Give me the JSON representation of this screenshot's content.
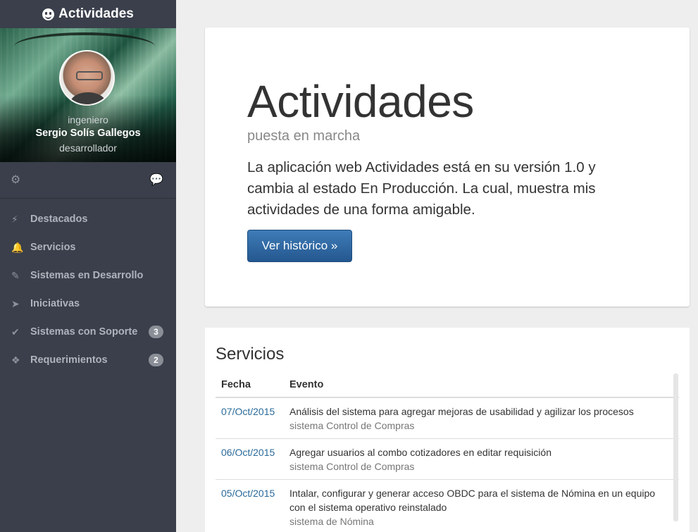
{
  "app": {
    "brand": "Actividades",
    "brand_icon": "smiley-icon"
  },
  "profile": {
    "title": "ingeniero",
    "name": "Sergio Solís Gallegos",
    "role": "desarrollador"
  },
  "tools": {
    "settings_icon": "gear-icon",
    "chat_icon": "comment-icon"
  },
  "menu": {
    "items": [
      {
        "label": "Destacados",
        "icon": "bolt-icon",
        "glyph": "⚡",
        "badge": ""
      },
      {
        "label": "Servicios",
        "icon": "bell-icon",
        "glyph": "🔔",
        "badge": ""
      },
      {
        "label": "Sistemas en Desarrollo",
        "icon": "pencil-icon",
        "glyph": "✎",
        "badge": ""
      },
      {
        "label": "Iniciativas",
        "icon": "send-icon",
        "glyph": "➤",
        "badge": ""
      },
      {
        "label": "Sistemas con Soporte",
        "icon": "check-icon",
        "glyph": "✔",
        "badge": "3"
      },
      {
        "label": "Requerimientos",
        "icon": "gift-icon",
        "glyph": "❖",
        "badge": "2"
      }
    ]
  },
  "jumbotron": {
    "title": "Actividades",
    "subtitle": "puesta en marcha",
    "lead": "La aplicación web Actividades está en su versión 1.0 y cambia al estado En Producción. La cual, muestra mis actividades de una forma amigable.",
    "button": "Ver histórico »"
  },
  "services": {
    "heading": "Servicios",
    "columns": [
      "Fecha",
      "Evento"
    ],
    "rows": [
      {
        "date": "07/Oct/2015",
        "event": "Análisis del sistema para agregar mejoras de usabilidad y agilizar los procesos",
        "system": "sistema Control de Compras"
      },
      {
        "date": "06/Oct/2015",
        "event": "Agregar usuarios al combo cotizadores en editar requisición",
        "system": "sistema Control de Compras"
      },
      {
        "date": "05/Oct/2015",
        "event": "Intalar, configurar y generar acceso OBDC para el sistema de Nómina en un equipo con el sistema operativo reinstalado",
        "system": "sistema de Nómina"
      }
    ]
  },
  "colors": {
    "sidebar": "#3a3f4b",
    "button": "#2d6aa5",
    "link": "#2a6a9a",
    "background": "#eeeeee"
  }
}
